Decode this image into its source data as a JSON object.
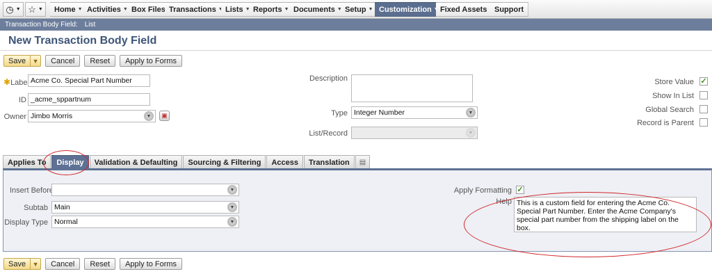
{
  "nav": {
    "items": [
      {
        "label": "Home",
        "dropdown": true
      },
      {
        "label": "Activities",
        "dropdown": true
      },
      {
        "label": "Box Files",
        "dropdown": false
      },
      {
        "label": "Transactions",
        "dropdown": true
      },
      {
        "label": "Lists",
        "dropdown": true
      },
      {
        "label": "Reports",
        "dropdown": true
      },
      {
        "label": "Documents",
        "dropdown": true
      },
      {
        "label": "Setup",
        "dropdown": true
      },
      {
        "label": "Customization",
        "dropdown": true,
        "active": true
      },
      {
        "label": "Fixed Assets",
        "dropdown": true
      },
      {
        "label": "Support",
        "dropdown": false
      }
    ],
    "icons": [
      "clock-icon",
      "star-icon"
    ]
  },
  "breadcrumb": {
    "section": "Transaction Body Field:",
    "link": "List"
  },
  "page": {
    "title": "New Transaction Body Field"
  },
  "buttons": {
    "save": "Save",
    "cancel": "Cancel",
    "reset": "Reset",
    "apply": "Apply to Forms"
  },
  "form": {
    "label": {
      "label": "Label",
      "value": "Acme Co. Special Part Number"
    },
    "id": {
      "label": "ID",
      "value": "_acme_sppartnum"
    },
    "owner": {
      "label": "Owner",
      "value": "Jimbo Morris"
    },
    "description": {
      "label": "Description",
      "value": ""
    },
    "type": {
      "label": "Type",
      "value": "Integer Number"
    },
    "list_record": {
      "label": "List/Record",
      "value": ""
    },
    "checkboxes": [
      {
        "label": "Store Value",
        "checked": true
      },
      {
        "label": "Show In List",
        "checked": false
      },
      {
        "label": "Global Search",
        "checked": false
      },
      {
        "label": "Record is Parent",
        "checked": false
      }
    ]
  },
  "tabs": [
    {
      "label": "Applies To"
    },
    {
      "label": "Display",
      "active": true
    },
    {
      "label": "Validation & Defaulting"
    },
    {
      "label": "Sourcing & Filtering"
    },
    {
      "label": "Access"
    },
    {
      "label": "Translation"
    }
  ],
  "display": {
    "insert_before": {
      "label": "Insert Before",
      "value": ""
    },
    "subtab": {
      "label": "Subtab",
      "value": "Main"
    },
    "display_type": {
      "label": "Display Type",
      "value": "Normal"
    },
    "apply_formatting": {
      "label": "Apply Formatting",
      "checked": true
    },
    "help": {
      "label": "Help",
      "value": "This is a custom field for entering the Acme Co. Special Part Number.  Enter the Acme Company's special part number from the shipping label on the box."
    }
  },
  "colors": {
    "nav_active": "#5b6e8f",
    "title": "#3d5577",
    "annotation": "#d0262a",
    "check": "#3a8f1f"
  }
}
